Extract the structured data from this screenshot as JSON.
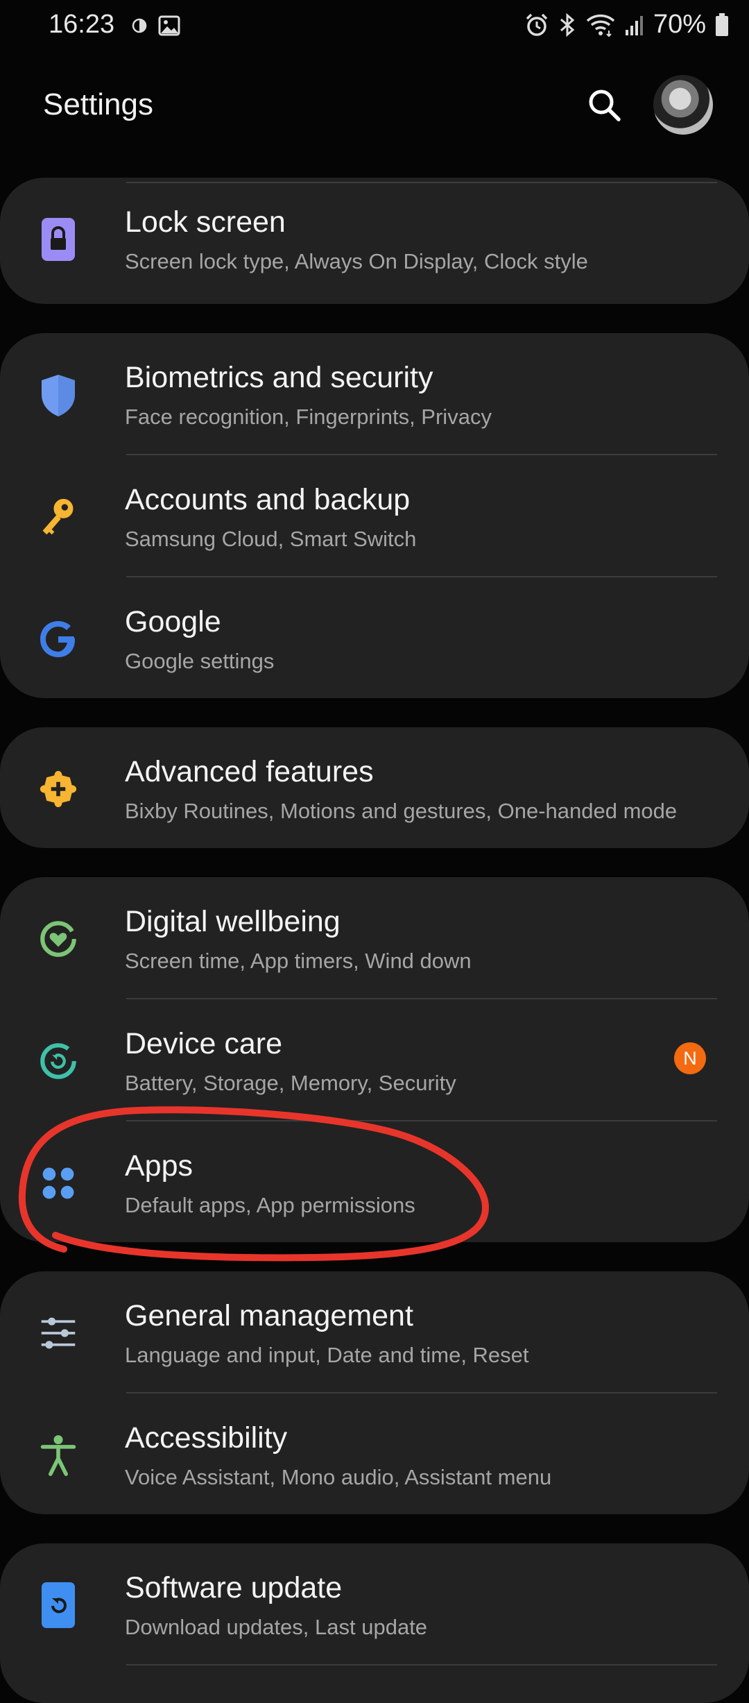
{
  "status_bar": {
    "time": "16:23",
    "battery": "70%"
  },
  "header": {
    "title": "Settings"
  },
  "items": [
    {
      "title": "Lock screen",
      "subtitle": "Screen lock type, Always On Display, Clock style",
      "icon": "lock-icon",
      "icon_color": "#9b8cf5"
    },
    {
      "title": "Biometrics and security",
      "subtitle": "Face recognition, Fingerprints, Privacy",
      "icon": "shield-icon",
      "icon_color": "#6f9cf2"
    },
    {
      "title": "Accounts and backup",
      "subtitle": "Samsung Cloud, Smart Switch",
      "icon": "key-icon",
      "icon_color": "#f7b531"
    },
    {
      "title": "Google",
      "subtitle": "Google settings",
      "icon": "google-icon",
      "icon_color": "#3f7ee8"
    },
    {
      "title": "Advanced features",
      "subtitle": "Bixby Routines, Motions and gestures, One-handed mode",
      "icon": "puzzle-plus-icon",
      "icon_color": "#f7b531"
    },
    {
      "title": "Digital wellbeing",
      "subtitle": "Screen time, App timers, Wind down",
      "icon": "heart-circle-icon",
      "icon_color": "#7cc576"
    },
    {
      "title": "Device care",
      "subtitle": "Battery, Storage, Memory, Security",
      "icon": "refresh-circle-icon",
      "icon_color": "#3fc0a8"
    },
    {
      "title": "Apps",
      "subtitle": "Default apps, App permissions",
      "icon": "apps-grid-icon",
      "icon_color": "#5a9ef3"
    },
    {
      "title": "General management",
      "subtitle": "Language and input, Date and time, Reset",
      "icon": "sliders-icon",
      "icon_color": "#b9c7d8"
    },
    {
      "title": "Accessibility",
      "subtitle": "Voice Assistant, Mono audio, Assistant menu",
      "icon": "accessibility-icon",
      "icon_color": "#7cc576"
    },
    {
      "title": "Software update",
      "subtitle": "Download updates, Last update",
      "icon": "software-update-icon",
      "icon_color": "#3f8ff2"
    }
  ],
  "device_care_badge": "N",
  "annotation": {
    "color": "#e8352b"
  }
}
